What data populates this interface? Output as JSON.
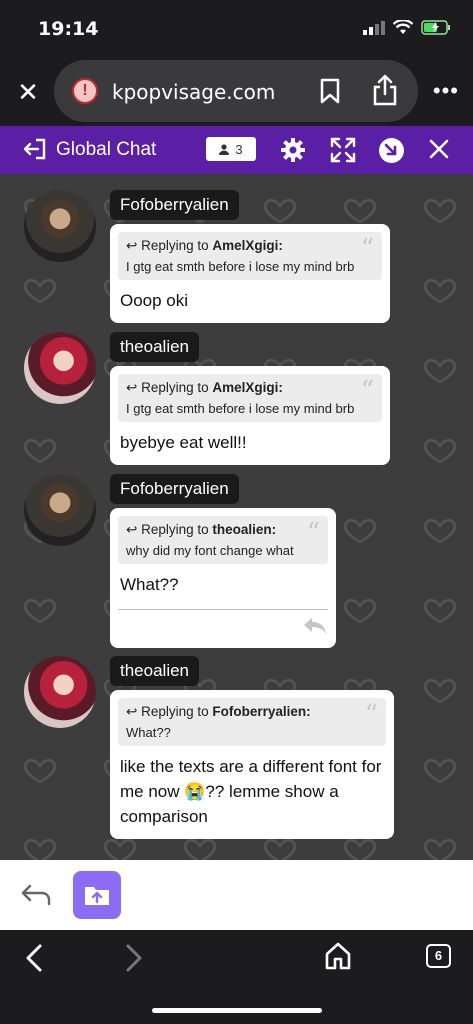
{
  "status": {
    "time": "19:14"
  },
  "browser": {
    "url": "kpopvisage.com",
    "tab_count": "6"
  },
  "chat": {
    "title": "Global Chat",
    "user_count": "3"
  },
  "messages": [
    {
      "username": "Fofoberryalien",
      "avatar": "boy",
      "reply_to": "AmelXgigi:",
      "reply_prefix": "Replying to",
      "reply_text": "I gtg eat smth before i lose my mind brb",
      "text": "Ooop oki"
    },
    {
      "username": "theoalien",
      "avatar": "girl",
      "reply_to": "AmelXgigi:",
      "reply_prefix": "Replying to",
      "reply_text": "I gtg eat smth before i lose my mind brb",
      "text": "byebye eat well!!"
    },
    {
      "username": "Fofoberryalien",
      "avatar": "boy",
      "reply_to": "theoalien:",
      "reply_prefix": "Replying to",
      "reply_text": "why did my font change what",
      "text": "What??"
    },
    {
      "username": "theoalien",
      "avatar": "girl",
      "reply_to": "Fofoberryalien:",
      "reply_prefix": "Replying to",
      "reply_text": "What??",
      "text": "like the texts are a different font for me now 😭?? lemme show a comparison"
    }
  ],
  "colors": {
    "header": "#5b1fa6",
    "upload_button": "#8c6cf2",
    "chat_bg": "#3d3d3d"
  }
}
